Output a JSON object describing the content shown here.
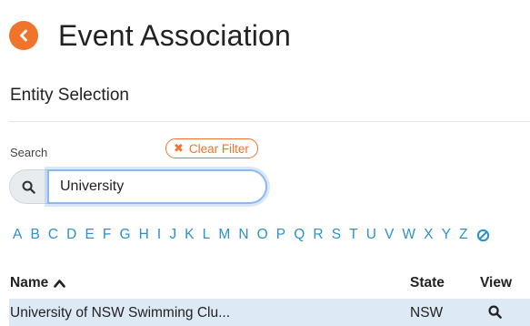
{
  "header": {
    "title": "Event Association",
    "back_icon": "arrow-left-icon",
    "accent": "#f0742c"
  },
  "section": {
    "title": "Entity Selection"
  },
  "search": {
    "label": "Search",
    "value": "University",
    "icon": "search-icon"
  },
  "clear_filter": {
    "label": "Clear Filter",
    "icon": "close-icon"
  },
  "alphabet": {
    "letters": [
      "A",
      "B",
      "C",
      "D",
      "E",
      "F",
      "G",
      "H",
      "I",
      "J",
      "K",
      "L",
      "M",
      "N",
      "O",
      "P",
      "Q",
      "R",
      "S",
      "T",
      "U",
      "V",
      "W",
      "X",
      "Y",
      "Z"
    ],
    "clear_icon": "ban-icon",
    "color": "#2e90c9"
  },
  "table": {
    "columns": {
      "name": "Name",
      "state": "State",
      "view": "View"
    },
    "sort_icon": "chevron-up-icon",
    "rows": [
      {
        "name": "University of NSW Swimming Clu...",
        "state": "NSW",
        "view_icon": "search-icon"
      }
    ],
    "selected_row_color": "#dde9f4"
  }
}
